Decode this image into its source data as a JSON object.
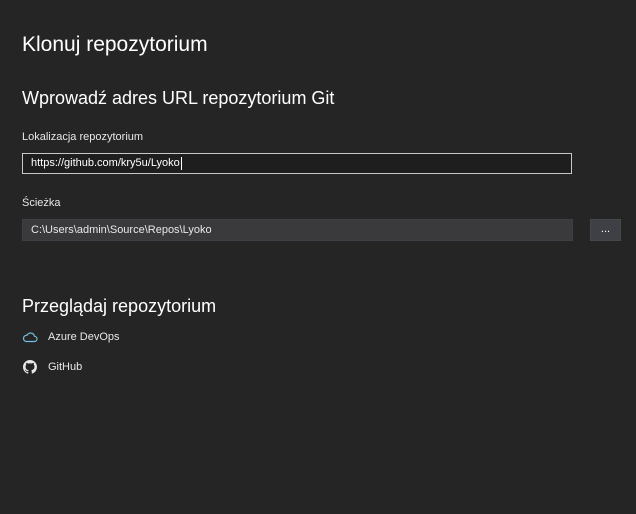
{
  "page": {
    "title": "Klonuj repozytorium"
  },
  "clone_url_section": {
    "title": "Wprowadź adres URL repozytorium Git",
    "location_label": "Lokalizacja repozytorium",
    "location_value": "https://github.com/kry5u/Lyoko",
    "path_label": "Ścieżka",
    "path_value": "C:\\Users\\admin\\Source\\Repos\\Lyoko",
    "browse_button_label": "..."
  },
  "browse_section": {
    "title": "Przeglądaj repozytorium",
    "providers": [
      {
        "name": "Azure DevOps",
        "icon": "cloud-icon",
        "icon_color": "#75bee0"
      },
      {
        "name": "GitHub",
        "icon": "github-icon",
        "icon_color": "#e8e8e8"
      }
    ]
  },
  "colors": {
    "background": "#252526",
    "input_border": "#c8c8c8",
    "path_background": "#3a3a3c"
  }
}
